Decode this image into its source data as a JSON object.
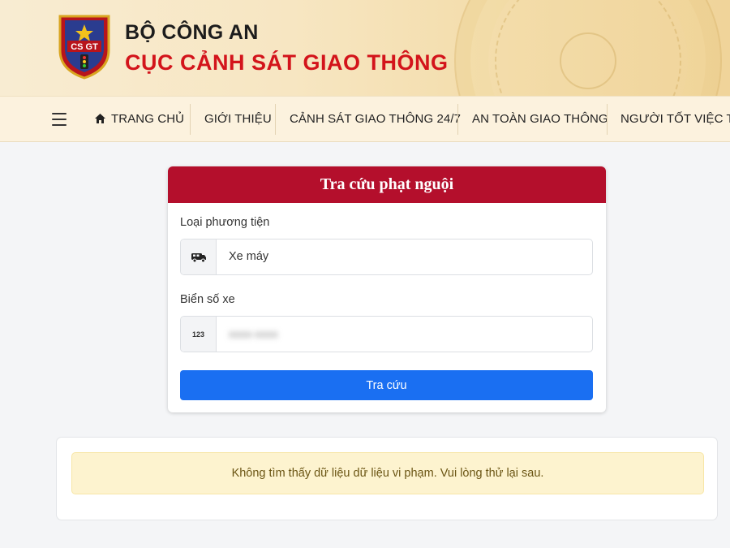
{
  "header": {
    "org_top": "BỘ CÔNG AN",
    "org_main": "CỤC CẢNH SÁT GIAO THÔNG",
    "emblem_text": "CSGT",
    "colors": {
      "brand_red": "#d3141b",
      "background": "#f7e6c2"
    }
  },
  "nav": {
    "menu_icon": "hamburger-menu-icon",
    "items": [
      {
        "label": "TRANG CHỦ",
        "icon": "home-icon"
      },
      {
        "label": "GIỚI THIỆU"
      },
      {
        "label": "CẢNH SÁT GIAO THÔNG 24/7"
      },
      {
        "label": "AN TOÀN GIAO THÔNG"
      },
      {
        "label": "NGƯỜI TỐT VIỆC TỐT"
      }
    ]
  },
  "search": {
    "title": "Tra cứu phạt nguội",
    "vehicle_type_label": "Loại phương tiện",
    "vehicle_type_icon": "truck-icon",
    "vehicle_type_value": "Xe máy",
    "plate_label": "Biển số xe",
    "plate_icon_text": "123",
    "plate_value": "xxxx-xxxx",
    "submit_label": "Tra cứu",
    "colors": {
      "header": "#b40f2c",
      "button": "#1a6ff2"
    }
  },
  "result": {
    "message": "Không tìm thấy dữ liệu dữ liệu vi phạm. Vui lòng thử lại sau.",
    "colors": {
      "alert_bg": "#fdf3cf",
      "alert_text": "#6b5514"
    }
  }
}
